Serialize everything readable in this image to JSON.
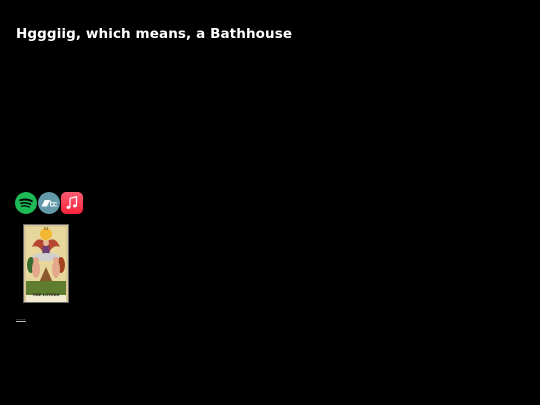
{
  "post": {
    "title": "Hgggiig, which means, a Bathhouse"
  },
  "music_links": [
    {
      "service": "Spotify",
      "icon": "spotify-icon",
      "color": "#1DB954"
    },
    {
      "service": "Bandcamp",
      "icon": "bandcamp-icon",
      "color": "#629AA9"
    },
    {
      "service": "Apple Music",
      "icon": "apple-music-icon",
      "color": "#FA243C"
    }
  ],
  "card": {
    "numeral": "VI",
    "caption": "THE LOVERS"
  },
  "more_link": "….."
}
